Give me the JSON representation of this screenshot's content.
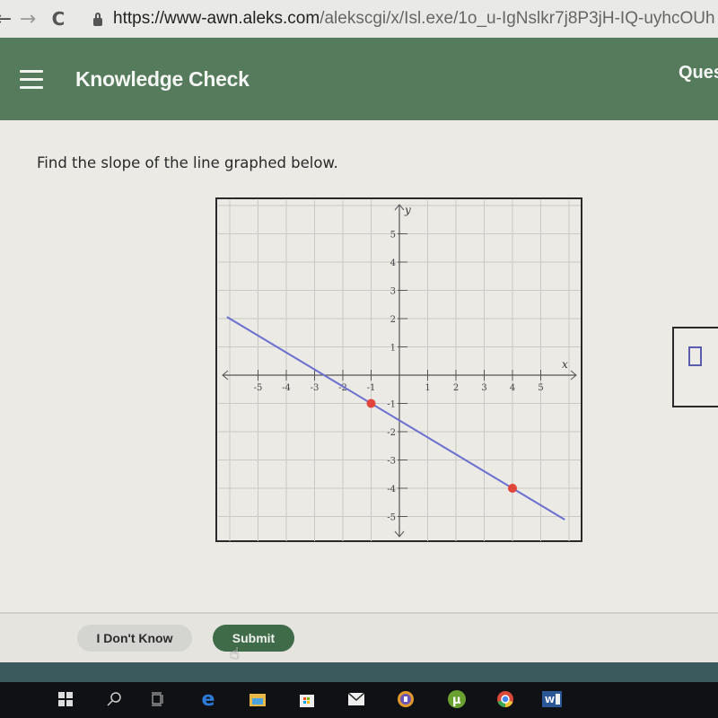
{
  "browser": {
    "back_icon": "←",
    "forward_icon": "→",
    "reload_icon": "C",
    "url_scheme_host": "https://www-awn.aleks.com",
    "url_path": "/alekscgi/x/Isl.exe/1o_u-IgNslkr7j8P3jH-IQ-uyhcOUh"
  },
  "header": {
    "title": "Knowledge Check",
    "right_text": "Ques"
  },
  "question": {
    "prompt": "Find the slope of the line graphed below."
  },
  "chart_data": {
    "type": "line",
    "title": "",
    "xlabel": "x",
    "ylabel": "y",
    "xlim": [
      -6,
      6
    ],
    "ylim": [
      -6,
      6
    ],
    "grid": true,
    "x_ticks": [
      -5,
      -4,
      -3,
      -2,
      -1,
      1,
      2,
      3,
      4,
      5
    ],
    "y_ticks": [
      -5,
      -4,
      -3,
      -2,
      -1,
      1,
      2,
      3,
      4,
      5
    ],
    "x_tick_labels": [
      "-5",
      "-4",
      "-3",
      "-2",
      "-1",
      "1",
      "2",
      "3",
      "4",
      "5"
    ],
    "y_tick_labels": [
      "-5",
      "-4",
      "-3",
      "-2",
      "-1",
      "1",
      "2",
      "3",
      "4",
      "5"
    ],
    "series": [
      {
        "name": "line",
        "color": "#6a6fd0",
        "points_marked": [
          [
            -1,
            -1
          ],
          [
            4,
            -4
          ]
        ],
        "slope": -0.6,
        "intercept": -1.6
      }
    ],
    "marker_color": "#e0463a"
  },
  "answer": {
    "value": ""
  },
  "footer": {
    "idk_label": "I Don't Know",
    "submit_label": "Submit"
  },
  "taskbar": {
    "icons": [
      "windows-start-icon",
      "search-icon",
      "task-view-icon",
      "edge-icon",
      "file-explorer-icon",
      "store-icon",
      "mail-icon",
      "vpn-icon",
      "utorrent-icon",
      "chrome-icon",
      "word-icon"
    ]
  }
}
